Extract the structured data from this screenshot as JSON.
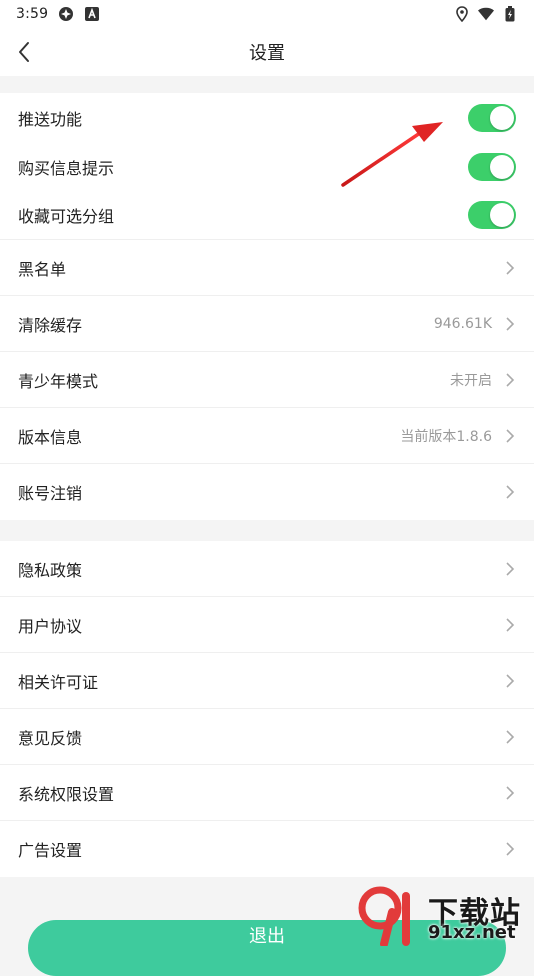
{
  "status_bar": {
    "time": "3:59"
  },
  "header": {
    "title": "设置"
  },
  "toggles": [
    {
      "label": "推送功能",
      "on": true
    },
    {
      "label": "购买信息提示",
      "on": true
    },
    {
      "label": "收藏可选分组",
      "on": true
    }
  ],
  "group1": [
    {
      "label": "黑名单",
      "value": ""
    },
    {
      "label": "清除缓存",
      "value": "946.61K"
    },
    {
      "label": "青少年模式",
      "value": "未开启"
    },
    {
      "label": "版本信息",
      "value": "当前版本1.8.6"
    },
    {
      "label": "账号注销",
      "value": ""
    }
  ],
  "group2": [
    {
      "label": "隐私政策"
    },
    {
      "label": "用户协议"
    },
    {
      "label": "相关许可证"
    },
    {
      "label": "意见反馈"
    },
    {
      "label": "系统权限设置"
    },
    {
      "label": "广告设置"
    }
  ],
  "logout": {
    "label": "退出"
  },
  "watermark": {
    "brand": "下载站",
    "domain": "91xz.net"
  },
  "colors": {
    "toggle_on": "#3ccf6a",
    "logout": "#3ecb9d",
    "arrow": "#e02424"
  }
}
